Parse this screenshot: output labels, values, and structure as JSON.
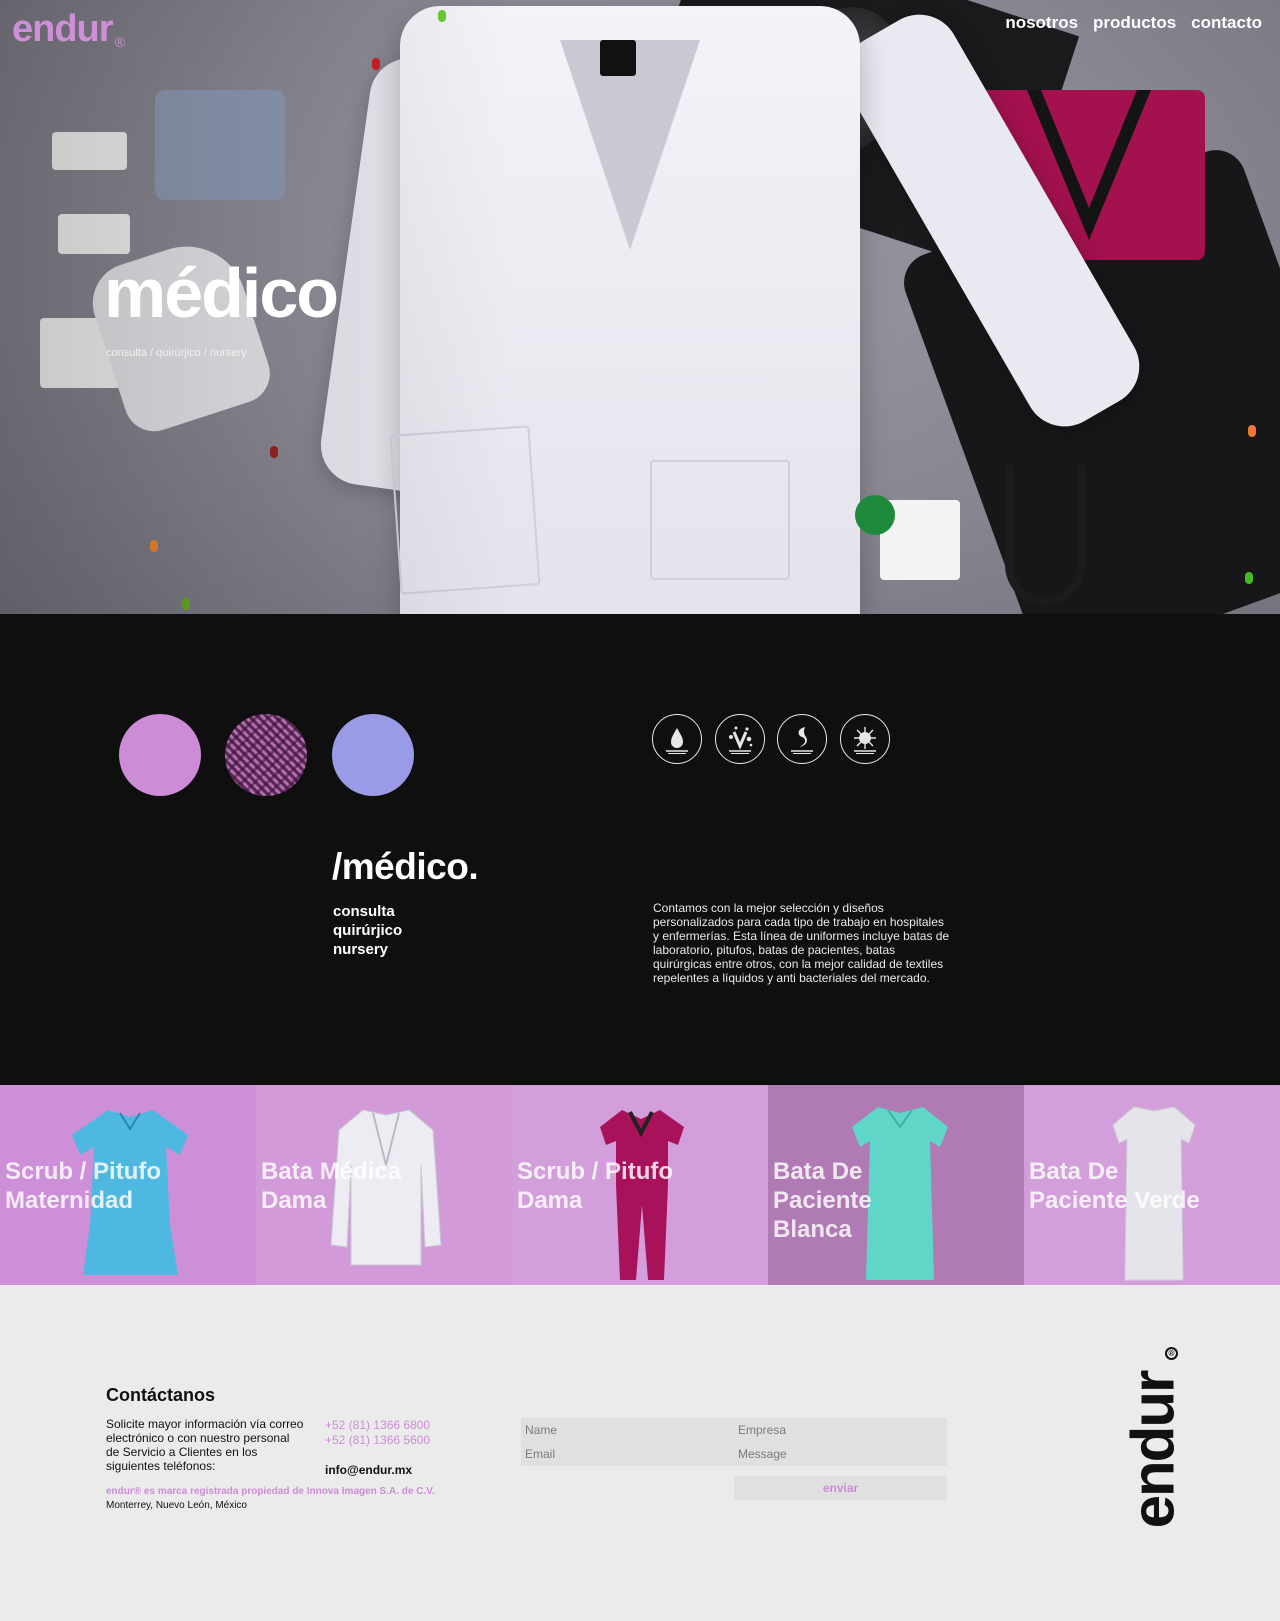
{
  "brand": {
    "name": "endur",
    "reg": "®",
    "accent": "#cc8cd6"
  },
  "nav": {
    "items": [
      "nosotros",
      "productos",
      "contacto"
    ]
  },
  "hero": {
    "title": "médico",
    "subtitle": "consulta / quirúrjico / nursery"
  },
  "section": {
    "swatches": [
      {
        "name": "lila",
        "color": "#cc8cd6"
      },
      {
        "name": "textura",
        "color": "#8f4a89"
      },
      {
        "name": "lavanda",
        "color": "#9a9be6"
      }
    ],
    "features": [
      "water-drop-icon",
      "antibacterial-icon",
      "stain-icon",
      "virus-icon"
    ],
    "title": "/médico.",
    "list": [
      "consulta",
      "quirúrjico",
      "nursery"
    ],
    "description": "Contamos con la mejor selección y diseños personalizados para cada tipo de trabajo en hospitales y enfermerías. Esta línea de uniformes incluye batas de laboratorio, pitufos, batas de pacientes, batas quirúrgicas entre otros, con la mejor calidad de textiles repelentes a líquidos y anti bacteriales del mercado."
  },
  "products": [
    {
      "line1": "Scrub / Pitufo",
      "line2": "Maternidad",
      "line3": "",
      "bg": "#cc8fd8",
      "garment": "#4fb8e0"
    },
    {
      "line1": "Bata Médica",
      "line2": "Dama",
      "line3": "",
      "bg": "#d29ad9",
      "garment": "#e9e9ee"
    },
    {
      "line1": "Scrub / Pitufo",
      "line2": "Dama",
      "line3": "",
      "bg": "#d39fdb",
      "garment": "#a8125a"
    },
    {
      "line1": "Bata De",
      "line2": "Paciente",
      "line3": "Blanca",
      "bg": "#b07ab4",
      "garment": "#5fd6c8"
    },
    {
      "line1": "Bata De",
      "line2": "Paciente Verde",
      "line3": "",
      "bg": "#d39fdb",
      "garment": "#e4e4ea"
    }
  ],
  "footer": {
    "title": "Contáctanos",
    "text": "Solicite mayor información vía correo electrónico o con nuestro personal de Servicio a Clientes en los siguientes teléfonos:",
    "phones": [
      "+52 (81) 1366 6800",
      "+52 (81) 1366 5600"
    ],
    "email": "info@endur.mx",
    "legal": "endur® es marca registrada propiedad de Innova Imagen S.A. de C.V.",
    "city": "Monterrey, Nuevo León, México",
    "form": {
      "name": "Name",
      "empresa": "Empresa",
      "email": "Email",
      "message": "Message",
      "send": "enviar"
    },
    "vertical_logo": "endur"
  }
}
